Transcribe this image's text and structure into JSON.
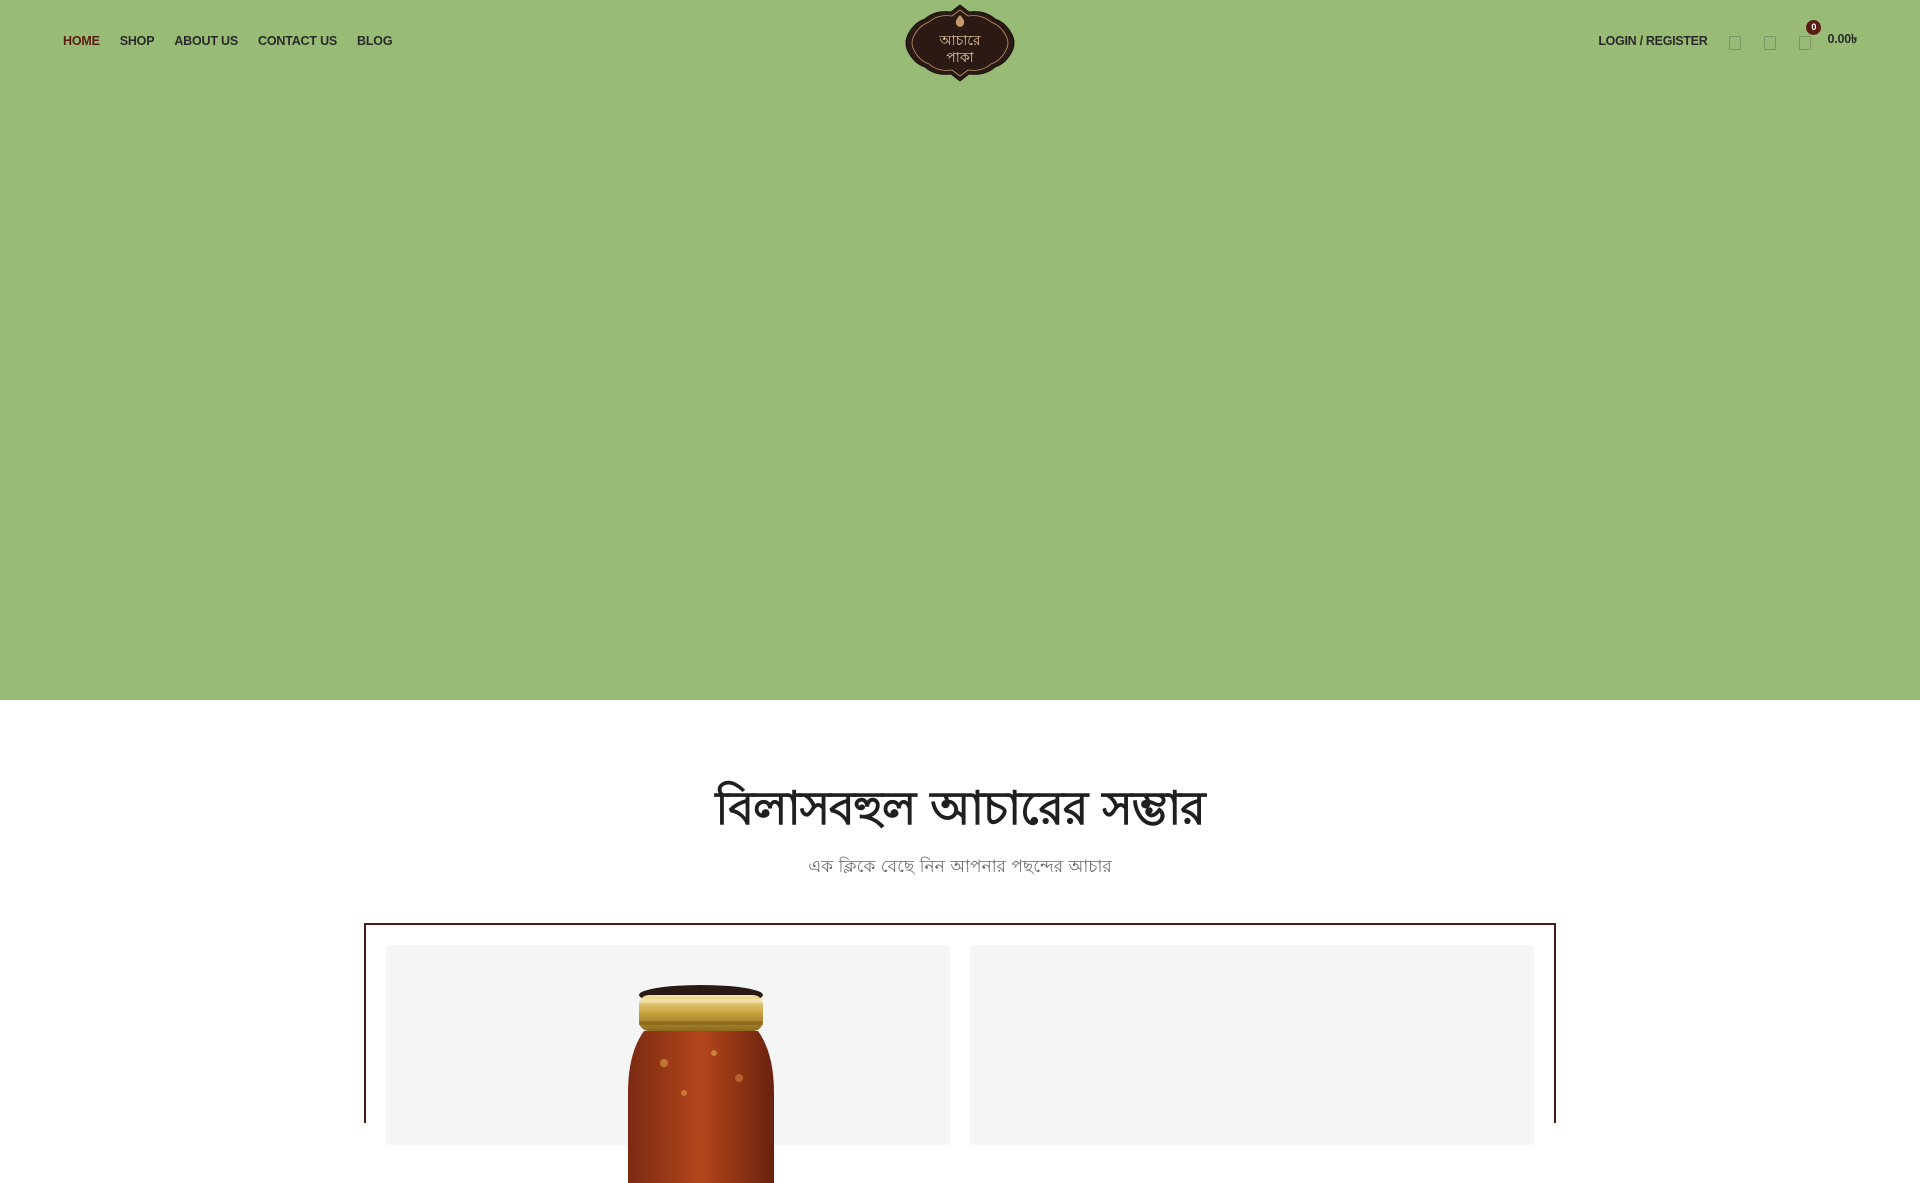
{
  "nav": {
    "items": [
      {
        "label": "HOME",
        "active": true
      },
      {
        "label": "SHOP",
        "active": false
      },
      {
        "label": "ABOUT US",
        "active": false
      },
      {
        "label": "CONTACT US",
        "active": false
      },
      {
        "label": "BLOG",
        "active": false
      }
    ]
  },
  "logo": {
    "line1": "আচারে",
    "line2": "পাকা"
  },
  "header_tools": {
    "login_label": "LOGIN / REGISTER",
    "icons": [
      "search-icon",
      "wishlist-icon",
      "cart-icon"
    ],
    "cart_count": "0",
    "cart_total": "0.00৳"
  },
  "section": {
    "title": "বিলাসবহুল আচারের সম্ভার",
    "subtitle": "এক ক্লিকে বেছে নিন আপনার পছন্দের আচার"
  },
  "colors": {
    "hero_bg": "#98bc76",
    "accent": "#5a1d14",
    "frame_border": "#4a1d18",
    "card_bg": "#f5f5f5"
  }
}
